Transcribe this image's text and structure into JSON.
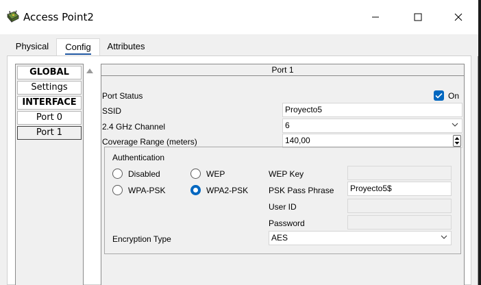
{
  "window": {
    "title": "Access Point2",
    "minimize_icon": "minimize-icon",
    "maximize_icon": "maximize-icon",
    "close_icon": "close-icon"
  },
  "tabs": [
    {
      "label": "Physical",
      "active": false
    },
    {
      "label": "Config",
      "active": true
    },
    {
      "label": "Attributes",
      "active": false
    }
  ],
  "nav": {
    "items": [
      {
        "label": "GLOBAL",
        "kind": "header"
      },
      {
        "label": "Settings",
        "kind": "item"
      },
      {
        "label": "INTERFACE",
        "kind": "header"
      },
      {
        "label": "Port 0",
        "kind": "item"
      },
      {
        "label": "Port 1",
        "kind": "item",
        "selected": true
      }
    ]
  },
  "port": {
    "title": "Port 1",
    "status_label": "Port Status",
    "status_checkbox_label": "On",
    "status_checked": true,
    "ssid_label": "SSID",
    "ssid_value": "Proyecto5",
    "channel_label": "2.4 GHz Channel",
    "channel_value": "6",
    "coverage_label": "Coverage Range (meters)",
    "coverage_value": "140,00"
  },
  "auth": {
    "title": "Authentication",
    "options": [
      {
        "label": "Disabled",
        "checked": false
      },
      {
        "label": "WEP",
        "checked": false
      },
      {
        "label": "WPA-PSK",
        "checked": false
      },
      {
        "label": "WPA2-PSK",
        "checked": true
      }
    ],
    "wep_key_label": "WEP Key",
    "wep_key_value": "",
    "psk_label": "PSK Pass Phrase",
    "psk_value": "Proyecto5$",
    "user_id_label": "User ID",
    "user_id_value": "",
    "password_label": "Password",
    "password_value": "",
    "encryption_label": "Encryption Type",
    "encryption_value": "AES"
  },
  "colors": {
    "accent": "#0067c0",
    "tab_underline": "#1e56a0"
  }
}
